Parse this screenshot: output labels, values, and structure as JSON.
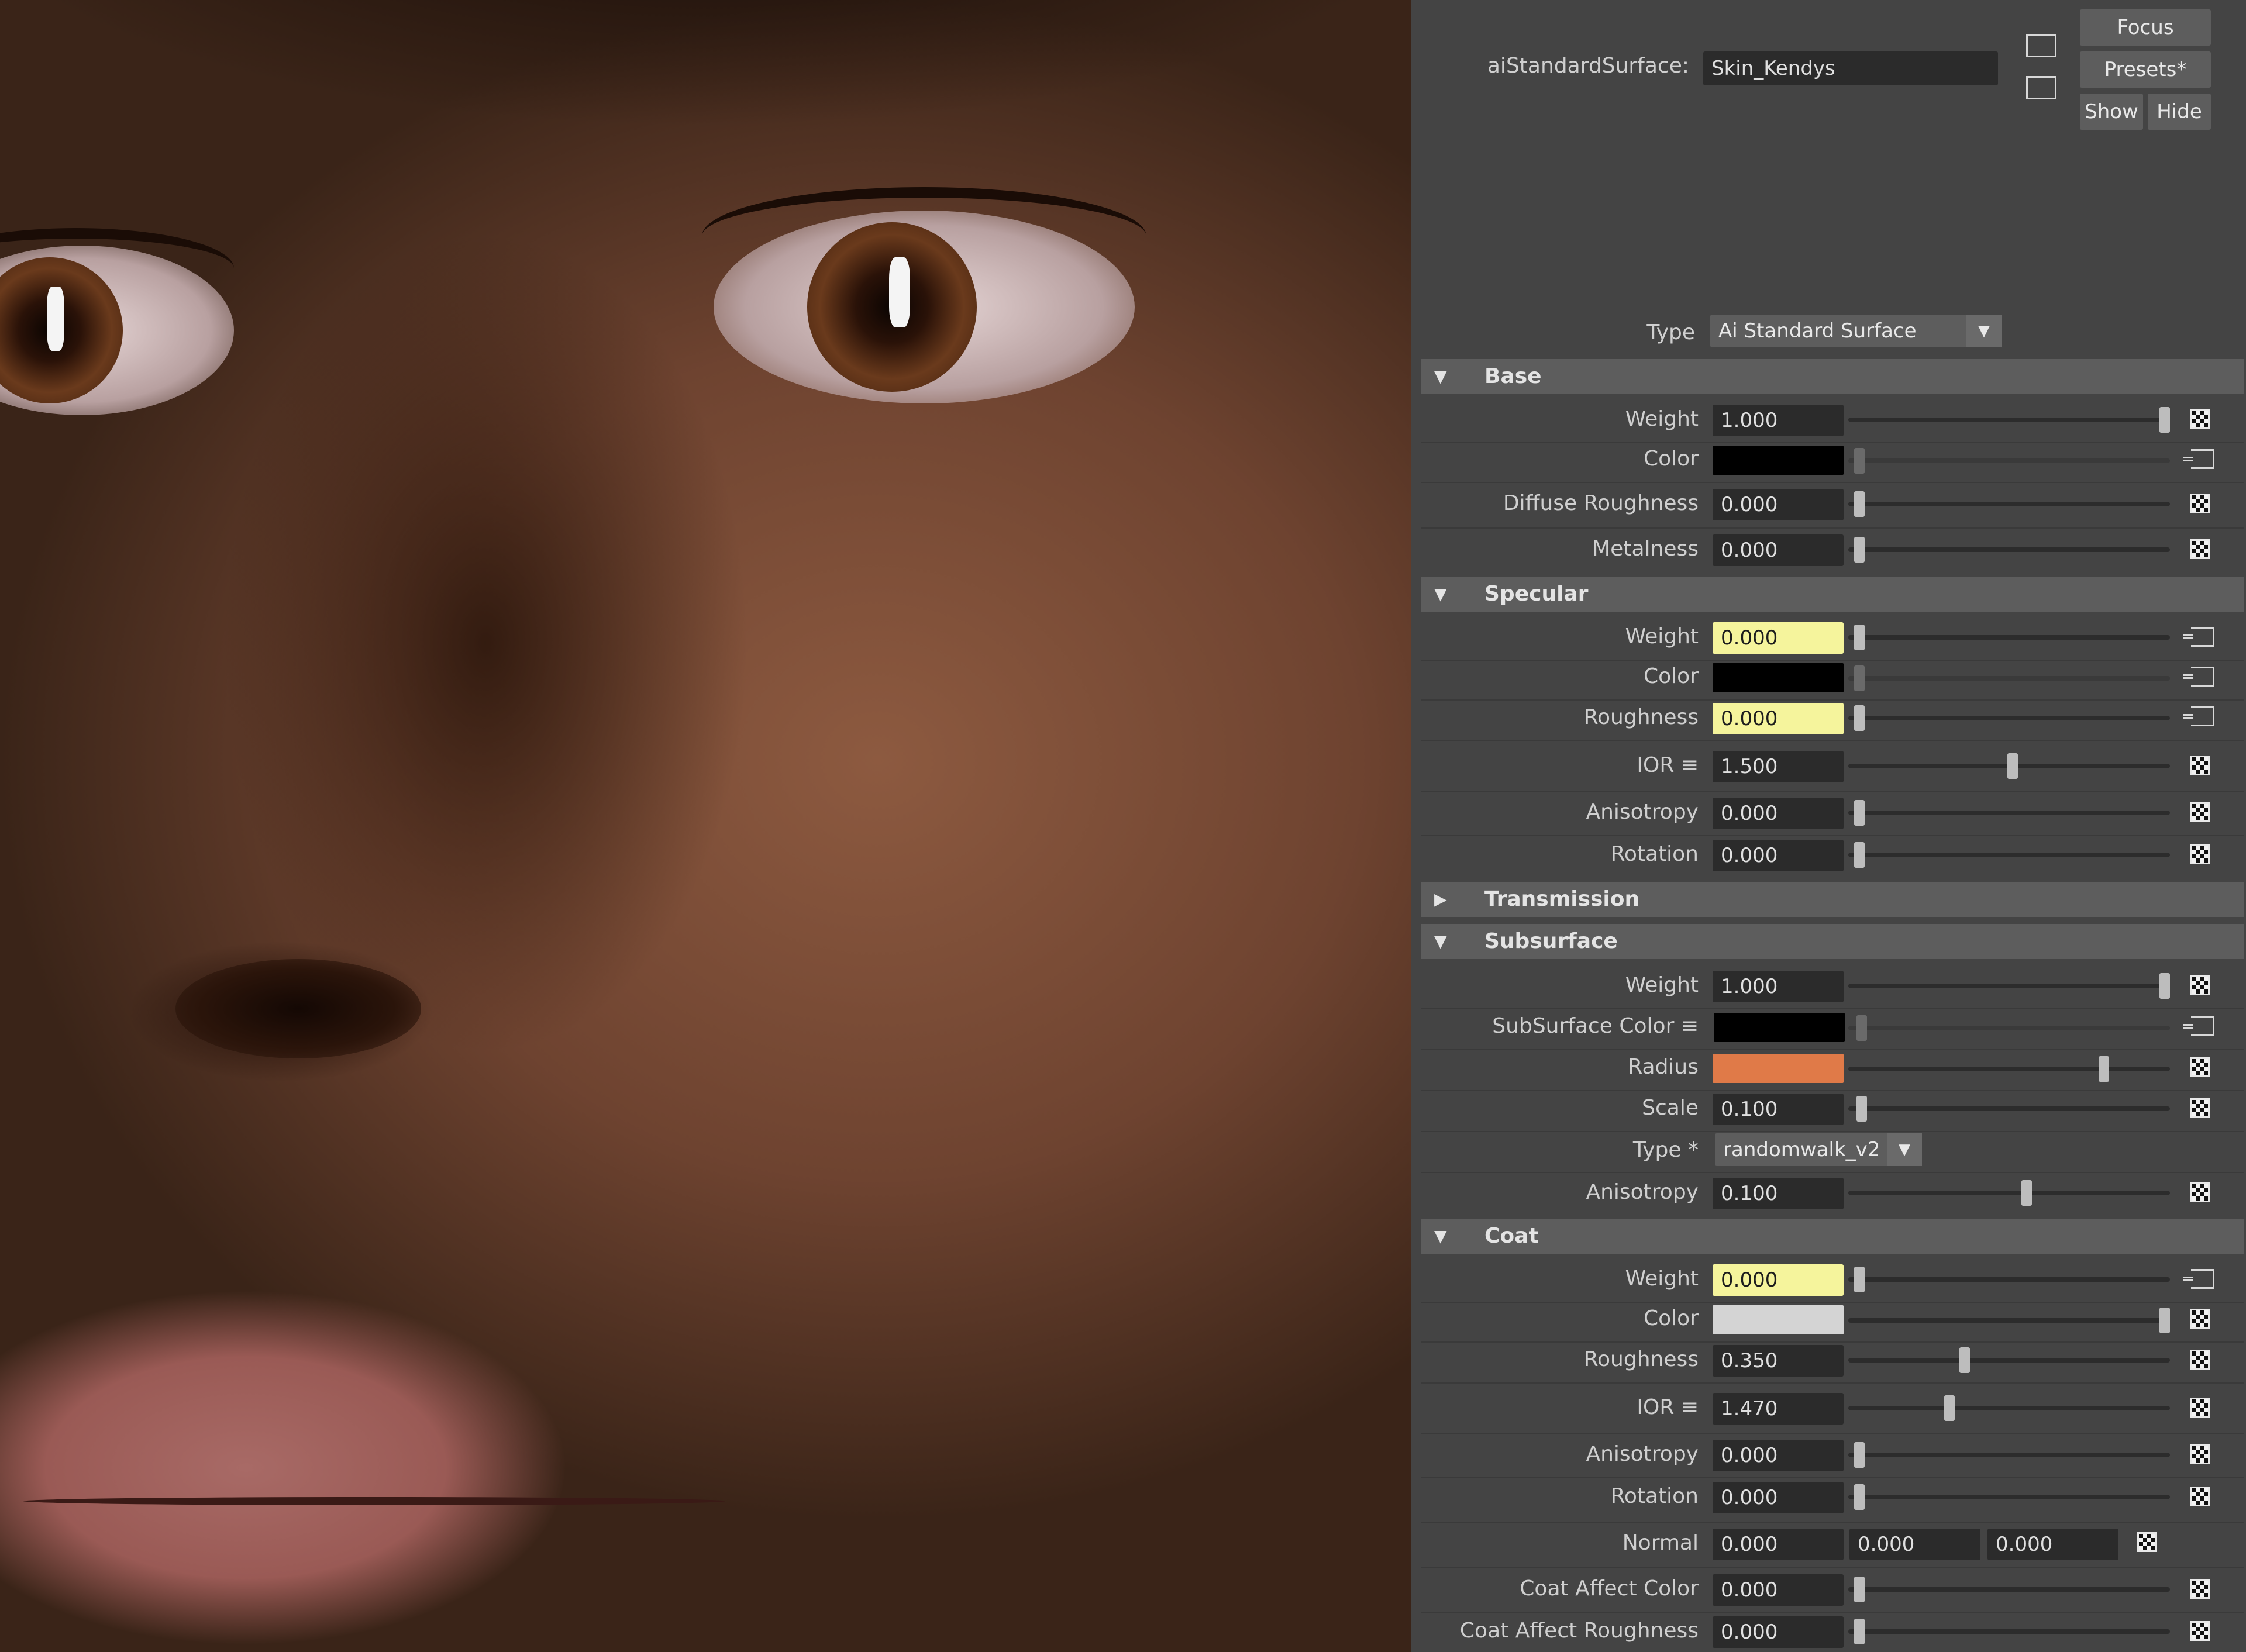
{
  "header": {
    "node_label": "aiStandardSurface:",
    "node_name": "Skin_Kendys",
    "buttons": {
      "focus": "Focus",
      "presets": "Presets*",
      "show": "Show",
      "hide": "Hide"
    },
    "type_label": "Type",
    "type_value": "Ai Standard Surface"
  },
  "sections": {
    "base": {
      "title": "Base",
      "expanded": true
    },
    "specular": {
      "title": "Specular",
      "expanded": true
    },
    "transmission": {
      "title": "Transmission",
      "expanded": false
    },
    "subsurface": {
      "title": "Subsurface",
      "expanded": true
    },
    "coat": {
      "title": "Coat",
      "expanded": true
    }
  },
  "base": {
    "weight": {
      "label": "Weight",
      "value": "1.000"
    },
    "color": {
      "label": "Color",
      "swatch": "#000000"
    },
    "diffuse_roughness": {
      "label": "Diffuse Roughness",
      "value": "0.000"
    },
    "metalness": {
      "label": "Metalness",
      "value": "0.000"
    }
  },
  "specular": {
    "weight": {
      "label": "Weight",
      "value": "0.000"
    },
    "color": {
      "label": "Color",
      "swatch": "#000000"
    },
    "roughness": {
      "label": "Roughness",
      "value": "0.000"
    },
    "ior": {
      "label": "IOR ≡",
      "value": "1.500"
    },
    "anisotropy": {
      "label": "Anisotropy",
      "value": "0.000"
    },
    "rotation": {
      "label": "Rotation",
      "value": "0.000"
    }
  },
  "subsurface": {
    "weight": {
      "label": "Weight",
      "value": "1.000"
    },
    "color": {
      "label": "SubSurface Color ≡",
      "swatch": "#000000"
    },
    "radius": {
      "label": "Radius",
      "swatch": "#e07a48"
    },
    "scale": {
      "label": "Scale",
      "value": "0.100"
    },
    "type": {
      "label": "Type *",
      "value": "randomwalk_v2"
    },
    "anisotropy": {
      "label": "Anisotropy",
      "value": "0.100"
    }
  },
  "coat": {
    "weight": {
      "label": "Weight",
      "value": "0.000"
    },
    "color": {
      "label": "Color",
      "swatch": "#d4d4d4"
    },
    "roughness": {
      "label": "Roughness",
      "value": "0.350"
    },
    "ior": {
      "label": "IOR ≡",
      "value": "1.470"
    },
    "anisotropy": {
      "label": "Anisotropy",
      "value": "0.000"
    },
    "rotation": {
      "label": "Rotation",
      "value": "0.000"
    },
    "normal": {
      "label": "Normal",
      "x": "0.000",
      "y": "0.000",
      "z": "0.000"
    },
    "affect_color": {
      "label": "Coat Affect Color",
      "value": "0.000"
    },
    "affect_roughness": {
      "label": "Coat Affect Roughness",
      "value": "0.000"
    }
  },
  "colors": {
    "panel_bg": "#444444",
    "section_header": "#5d5d5d",
    "field_bg": "#2b2b2b",
    "highlight_field": "#f5f49c"
  }
}
